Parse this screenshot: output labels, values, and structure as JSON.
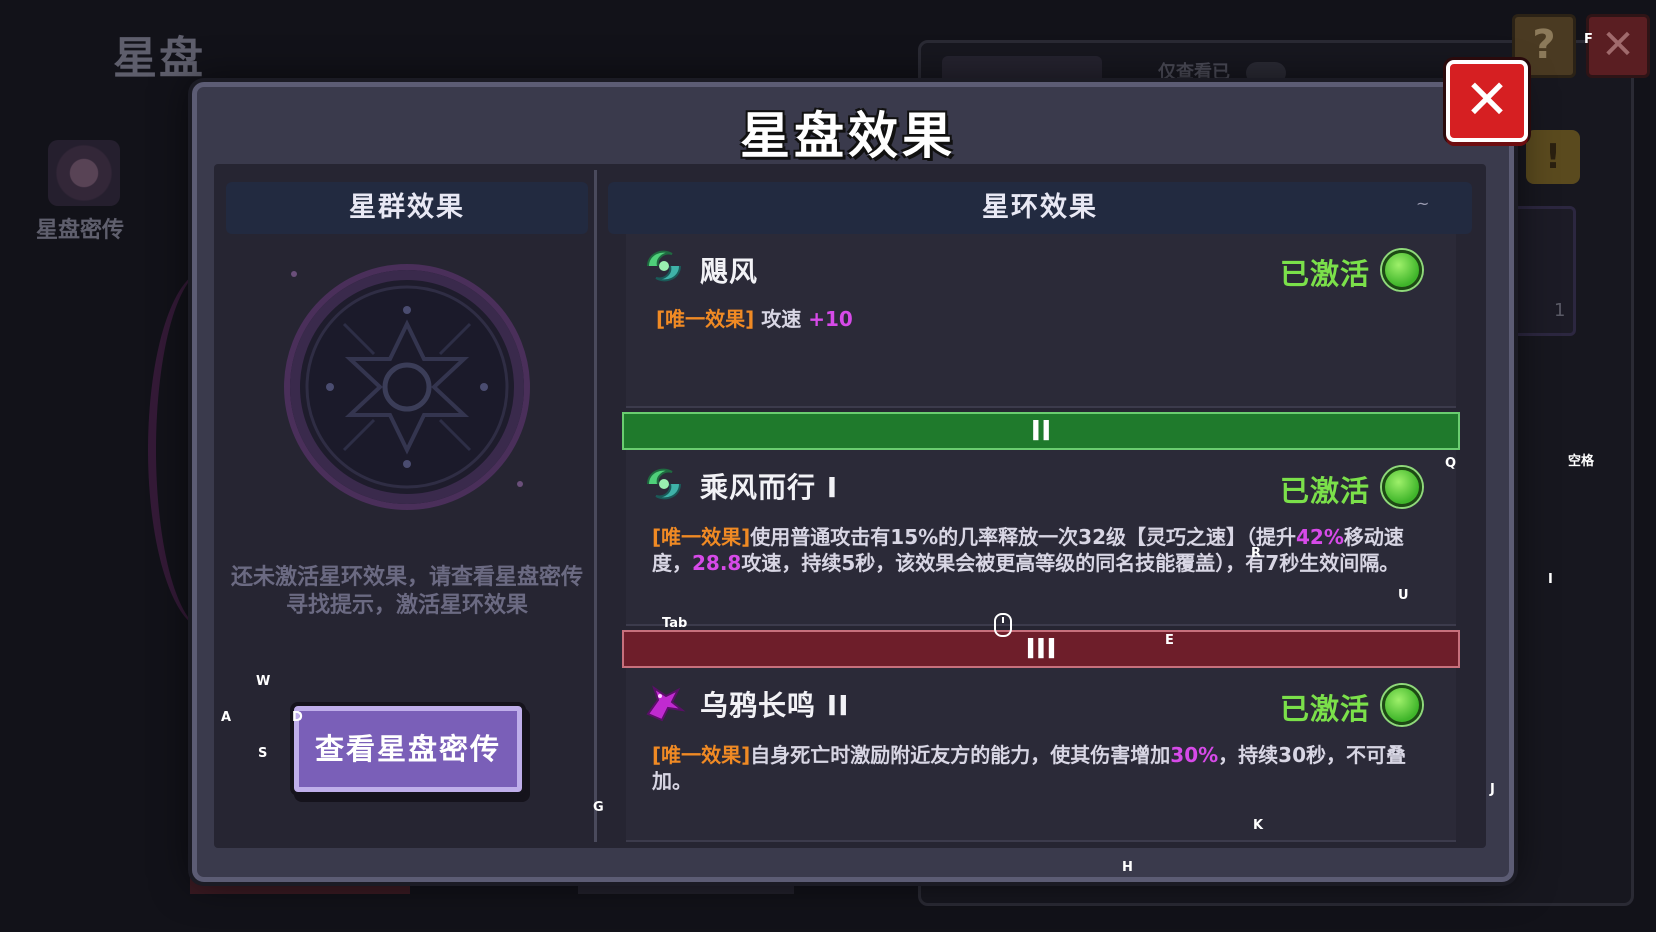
{
  "background": {
    "title": "星盘",
    "sidebar_label": "星盘密传",
    "panel_filter_label": "仅查看已",
    "card_count": "1",
    "help_icon": "question-icon",
    "close_icon": "close-icon",
    "warning_icon": "exclamation-icon"
  },
  "modal": {
    "title": "星盘效果",
    "close_icon": "close-icon",
    "left": {
      "header": "星群效果",
      "empty_hint": "还未激活星环效果，请查看星盘密传寻找提示，激活星环效果",
      "view_button": "查看星盘密传"
    },
    "right": {
      "header": "星环效果",
      "header_hint": "~",
      "effects": [
        {
          "name": "飓风",
          "status": "已激活",
          "icon": "wind-swirl-icon",
          "tag": "[唯一效果]",
          "desc_parts": [
            "攻速 ",
            "+10"
          ]
        },
        {
          "tier": "II",
          "name": "乘风而行 I",
          "status": "已激活",
          "icon": "wind-swirl-icon",
          "tag": "[唯一效果]",
          "desc_parts": [
            "使用普通攻击有15%的几率释放一次32级【灵巧之速】（提升",
            "42%",
            "移动速度，",
            "28.8",
            "攻速，持续5秒，该效果会被更高等级的同名技能覆盖），有7秒生效间隔。"
          ]
        },
        {
          "tier": "III",
          "name": "乌鸦长鸣 II",
          "status": "已激活",
          "icon": "crow-icon",
          "tag": "[唯一效果]",
          "desc_parts": [
            "自身死亡时激励附近友方的能力，使其伤害增加",
            "30%",
            "，持续30秒，不可叠加。"
          ]
        }
      ]
    }
  },
  "key_hints": {
    "w": "W",
    "a": "A",
    "s": "S",
    "d": "D",
    "g": "G",
    "h": "H",
    "k": "K",
    "j": "J",
    "e": "E",
    "tab": "Tab",
    "q": "Q",
    "u": "U",
    "i": "I",
    "f": "F",
    "space": "空格",
    "r": "R"
  },
  "colors": {
    "tag_orange": "#f08a24",
    "highlight_magenta": "#d64ae8",
    "status_green": "#7be04a",
    "tier2_green": "#1f7a2c",
    "tier3_red": "#6e1e2a",
    "button_purple": "#7a5fb8",
    "close_red": "#d61f22"
  }
}
